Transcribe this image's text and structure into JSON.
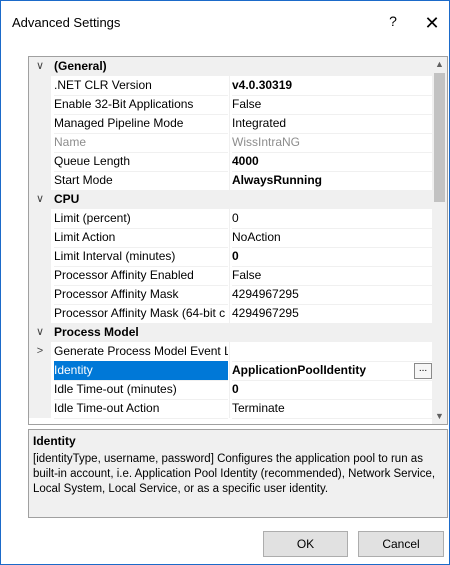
{
  "window": {
    "title": "Advanced Settings",
    "help_label": "?",
    "close_label": "✕"
  },
  "grid": {
    "sections": [
      {
        "label": "(General)",
        "expander": "∨",
        "rows": [
          {
            "name": ".NET CLR Version",
            "value": "v4.0.30319",
            "bold": true
          },
          {
            "name": "Enable 32-Bit Applications",
            "value": "False"
          },
          {
            "name": "Managed Pipeline Mode",
            "value": "Integrated"
          },
          {
            "name": "Name",
            "value": "WissIntraNG",
            "disabled": true
          },
          {
            "name": "Queue Length",
            "value": "4000",
            "bold": true
          },
          {
            "name": "Start Mode",
            "value": "AlwaysRunning",
            "bold": true
          }
        ]
      },
      {
        "label": "CPU",
        "expander": "∨",
        "rows": [
          {
            "name": "Limit (percent)",
            "value": "0"
          },
          {
            "name": "Limit Action",
            "value": "NoAction"
          },
          {
            "name": "Limit Interval (minutes)",
            "value": "0",
            "bold": true
          },
          {
            "name": "Processor Affinity Enabled",
            "value": "False"
          },
          {
            "name": "Processor Affinity Mask",
            "value": "4294967295"
          },
          {
            "name": "Processor Affinity Mask (64-bit c",
            "value": "4294967295"
          }
        ]
      },
      {
        "label": "Process Model",
        "expander": "∨",
        "rows": [
          {
            "name": "Generate Process Model Event L",
            "value": "",
            "expander": ">"
          },
          {
            "name": "Identity",
            "value": "ApplicationPoolIdentity",
            "selected": true,
            "ellipsis": "..."
          },
          {
            "name": "Idle Time-out (minutes)",
            "value": "0",
            "bold": true
          },
          {
            "name": "Idle Time-out Action",
            "value": "Terminate"
          }
        ]
      }
    ],
    "scroll_position": 0.0
  },
  "description": {
    "title": "Identity",
    "text": "[identityType, username, password] Configures the application pool to run as built-in account, i.e. Application Pool Identity (recommended), Network Service, Local System, Local Service, or as a specific user identity."
  },
  "buttons": {
    "ok_label": "OK",
    "cancel_label": "Cancel"
  },
  "colors": {
    "selection": "#0078d7",
    "border": "#1b6ac9"
  }
}
